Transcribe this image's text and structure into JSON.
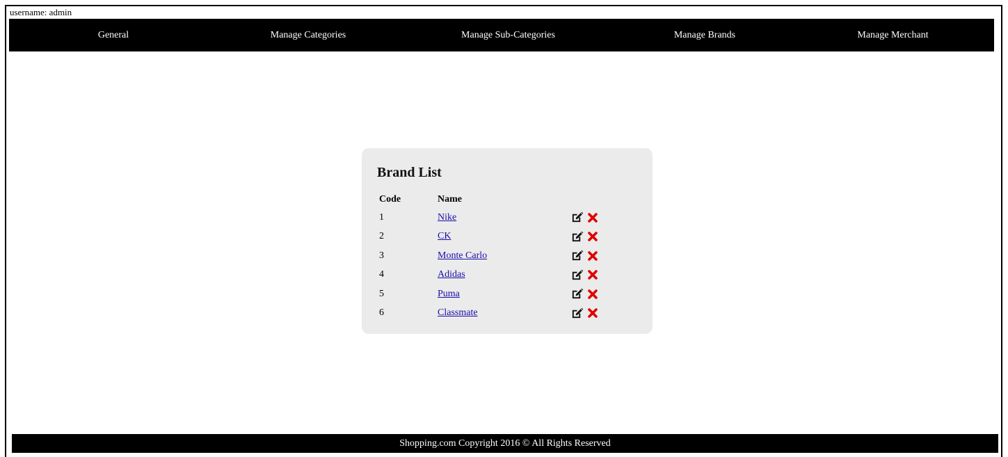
{
  "header": {
    "username_text": "username: admin"
  },
  "nav": {
    "items": [
      {
        "label": "General"
      },
      {
        "label": "Manage Categories"
      },
      {
        "label": "Manage Sub-Categories"
      },
      {
        "label": "Manage Brands"
      },
      {
        "label": "Manage Merchant"
      }
    ]
  },
  "brand_list": {
    "title": "Brand List",
    "columns": {
      "code": "Code",
      "name": "Name"
    },
    "rows": [
      {
        "code": "1",
        "name": "Nike"
      },
      {
        "code": "2",
        "name": "CK"
      },
      {
        "code": "3",
        "name": "Monte Carlo"
      },
      {
        "code": "4",
        "name": "Adidas"
      },
      {
        "code": "5",
        "name": "Puma"
      },
      {
        "code": "6",
        "name": "Classmate"
      }
    ],
    "icons": {
      "edit": "edit-icon",
      "delete": "delete-icon"
    },
    "colors": {
      "link": "#1a0dab",
      "delete": "#e00000",
      "panel": "#ebebeb"
    }
  },
  "footer": {
    "text": "Shopping.com Copyright 2016 © All Rights Reserved"
  }
}
